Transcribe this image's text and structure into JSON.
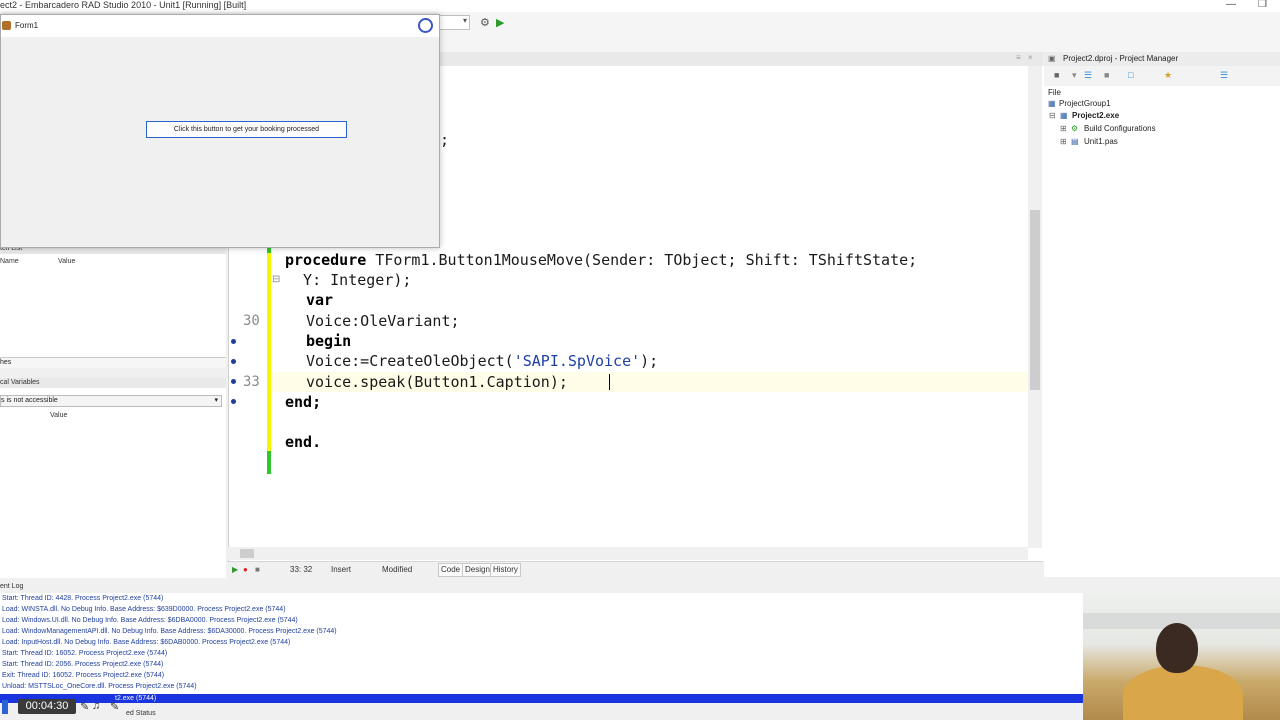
{
  "window": {
    "title": "ect2 - Embarcadero RAD Studio 2010 - Unit1 [Running] [Built]"
  },
  "form1": {
    "title": "Form1",
    "button_caption": "Click this button to get your booking processed"
  },
  "editor": {
    "line_numbers": {
      "l30": "30",
      "l33": "33"
    },
    "fragment": ";",
    "code": {
      "proc_kw": "procedure",
      "proc_sig": " TForm1.Button1MouseMove(Sender: TObject; Shift: TShiftState;",
      "line2": "  Y: Integer);",
      "var_kw": "var",
      "line4": "Voice:OleVariant;",
      "begin_kw": "begin",
      "line6_a": "Voice:=CreateOleObject(",
      "line6_str": "'SAPI.SpVoice'",
      "line6_b": ");",
      "line7": "voice.speak(Button1.Caption);",
      "end1": "end;",
      "end2": "end."
    },
    "status": {
      "position": "33: 32",
      "mode": "Insert",
      "state": "Modified"
    },
    "tabs": [
      "Code",
      "Design",
      "History"
    ]
  },
  "watch": {
    "title": "tch List",
    "col_name": "Name",
    "col_value": "Value",
    "tab": "hes"
  },
  "locals": {
    "title": "cal Variables",
    "message": "s is not accessible",
    "col_value": "Value"
  },
  "project_manager": {
    "title": "Project2.dproj - Project Manager",
    "file_label": "File",
    "group": "ProjectGroup1",
    "project": "Project2.exe",
    "build": "Build Configurations",
    "unit": "Unit1.pas"
  },
  "event_log": {
    "title": "ent Log",
    "lines": [
      "Start: Thread ID: 4428. Process Project2.exe (5744)",
      "Load: WINSTA.dll. No Debug Info. Base Address: $639D0000. Process Project2.exe (5744)",
      "Load: Windows.UI.dll. No Debug Info. Base Address: $6DBA0000. Process Project2.exe (5744)",
      "Load: WindowManagementAPI.dll. No Debug Info. Base Address: $6DA30000. Process Project2.exe (5744)",
      "Load: InputHost.dll. No Debug Info. Base Address: $6DAB0000. Process Project2.exe (5744)",
      "Start: Thread ID: 16052. Process Project2.exe (5744)",
      "Start: Thread ID: 2056. Process Project2.exe (5744)",
      "Exit: Thread ID: 16052. Process Project2.exe (5744)",
      "Unload: MSTTSLoc_OneCore.dll. Process Project2.exe (5744)"
    ],
    "selected": "t2.exe (5744)"
  },
  "bottom": {
    "status_fragment": "ed Status"
  },
  "video": {
    "timestamp": "00:04:30"
  }
}
